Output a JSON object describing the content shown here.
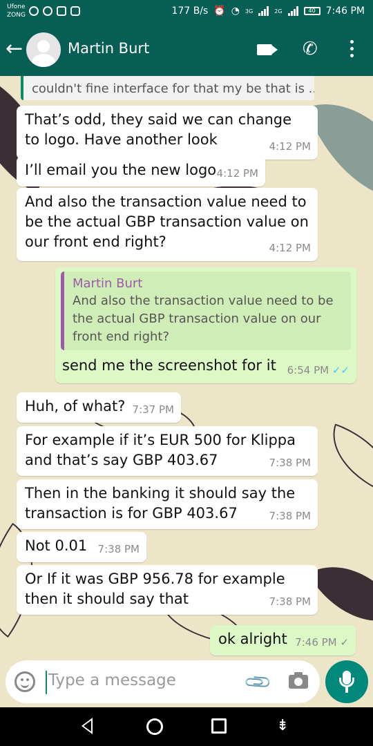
{
  "status_bar": {
    "carrier_1": "Ufone",
    "carrier_2": "ZONG",
    "speed": "177 B/s",
    "network_1": "3G",
    "network_2": "2G",
    "battery": "40",
    "time": "7:46 PM"
  },
  "header": {
    "contact_name": "Martin Burt",
    "back_icon": "arrow-left",
    "icons": [
      "video-call-icon",
      "phone-icon",
      "more-vert-icon"
    ]
  },
  "messages": [
    {
      "direction": "in",
      "type": "quote-fragment",
      "text": "couldn't fine interface for that my be that is ..."
    },
    {
      "direction": "in",
      "text": "That’s odd, they said we can change to logo. Have another look",
      "time": "4:12 PM"
    },
    {
      "direction": "in",
      "text": "I’ll email you the new logo",
      "time": "4:12 PM"
    },
    {
      "direction": "in",
      "text": "And also the transaction value need to be the actual GBP transaction value on our front end right?",
      "time": "4:12 PM"
    },
    {
      "direction": "out",
      "quote_name": "Martin Burt",
      "quote_text": "And also the transaction value need to be the actual GBP transaction value on our front end right?",
      "text": "send me the screenshot for it",
      "time": "6:54 PM",
      "status": "read"
    },
    {
      "direction": "in",
      "text": "Huh, of what?",
      "time": "7:37 PM"
    },
    {
      "direction": "in",
      "text": "For example if it’s EUR 500 for Klippa and that’s say GBP 403.67",
      "time": "7:38 PM"
    },
    {
      "direction": "in",
      "text": "Then in the banking it should say the transaction is for GBP 403.67",
      "time": "7:38 PM"
    },
    {
      "direction": "in",
      "text": "Not 0.01",
      "time": "7:38 PM"
    },
    {
      "direction": "in",
      "text": "Or If it was GBP 956.78 for example then it should say that",
      "time": "7:38 PM"
    },
    {
      "direction": "out",
      "text": "ok alright",
      "time": "7:46 PM",
      "status": "sent"
    }
  ],
  "composer": {
    "placeholder": "Type a message",
    "icons": [
      "emoji-icon",
      "attach-icon",
      "camera-icon",
      "mic-icon"
    ]
  },
  "nav_bar": [
    "back",
    "home",
    "recents",
    "notifications-down"
  ],
  "colors": {
    "header": "#075e54",
    "incoming_bubble": "#ffffff",
    "outgoing_bubble": "#dcf8c6",
    "wallpaper": "#ece5c8",
    "read_tick": "#4fc3f7",
    "mic_button": "#00897b",
    "quote_accent": "#9e5aa6"
  }
}
